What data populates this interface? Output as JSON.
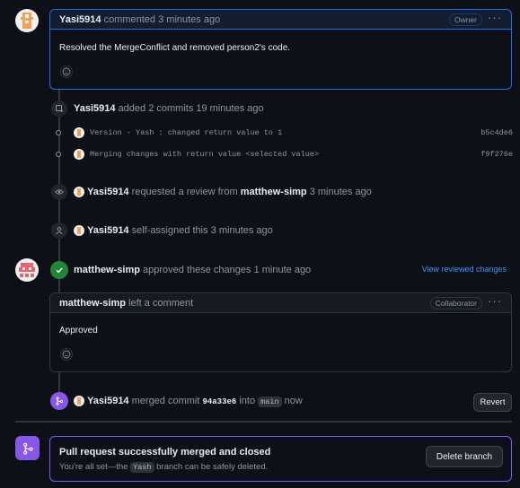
{
  "comment1": {
    "author": "Yasi5914",
    "action": "commented",
    "time": "3 minutes ago",
    "badge": "Owner",
    "body": "Resolved the MergeConflict and removed person2's code."
  },
  "commits_event": {
    "author": "Yasi5914",
    "text": "added 2 commits",
    "time": "19 minutes ago",
    "commits": [
      {
        "message": "Version - Yash : changed return value to 1",
        "sha": "b5c4de6"
      },
      {
        "message": "Merging changes with return value <selected value>",
        "sha": "f9f276e"
      }
    ]
  },
  "review_request": {
    "author": "Yasi5914",
    "text": "requested a review from",
    "reviewer": "matthew-simp",
    "time": "3 minutes ago"
  },
  "self_assign": {
    "author": "Yasi5914",
    "text": "self-assigned this",
    "time": "3 minutes ago"
  },
  "approval": {
    "author": "matthew-simp",
    "text": "approved these changes",
    "time": "1 minute ago",
    "link": "View reviewed changes"
  },
  "comment2": {
    "author": "matthew-simp",
    "action": "left a comment",
    "badge": "Collaborator",
    "body": "Approved"
  },
  "merge_event": {
    "author": "Yasi5914",
    "text": "merged commit",
    "sha": "94a33e6",
    "into": "into",
    "branch": "main",
    "time": "now",
    "revert_label": "Revert"
  },
  "merged_panel": {
    "title": "Pull request successfully merged and closed",
    "pre": "You're all set—the",
    "branch": "Yash",
    "post": "branch can be safely deleted.",
    "delete_label": "Delete branch"
  },
  "colors": {
    "owner_border": "#1f6feb",
    "approve_green": "#238636",
    "merged_purple": "#8957e5",
    "link_blue": "#4493f8"
  },
  "icons": {
    "kebab": "kebab-horizontal-icon",
    "smiley": "smiley-icon",
    "commit": "git-commit-icon",
    "eye": "eye-icon",
    "person": "person-icon",
    "check": "check-icon",
    "merge": "git-merge-icon"
  }
}
